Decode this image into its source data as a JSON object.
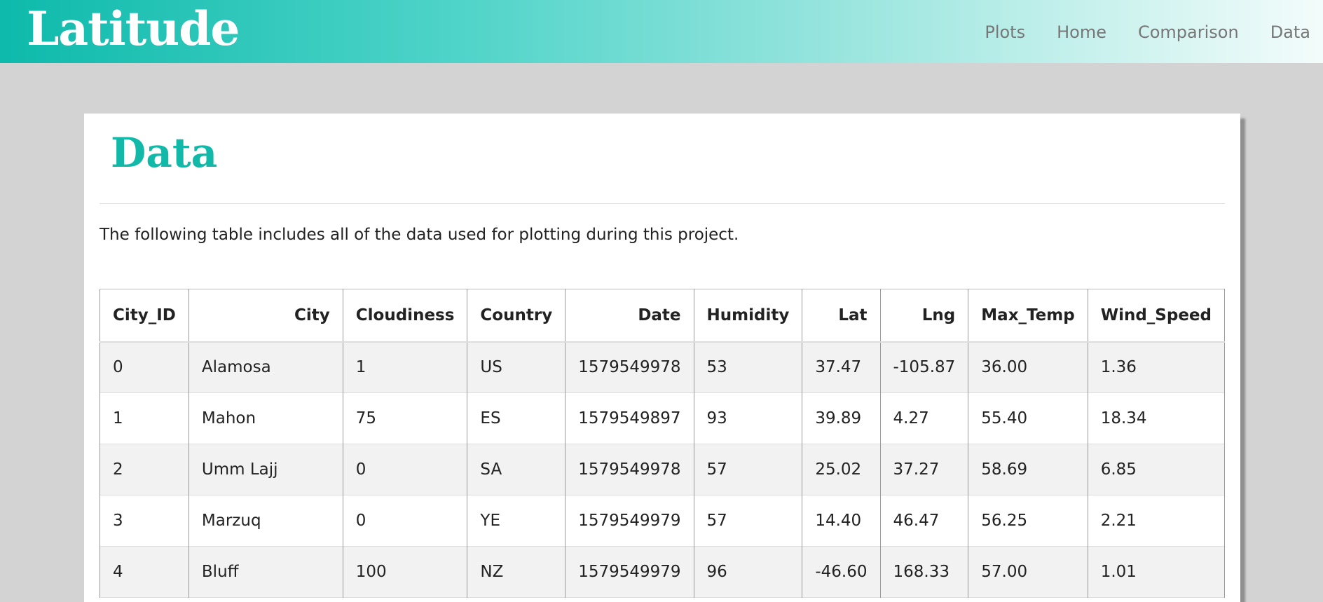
{
  "navbar": {
    "brand": "Latitude",
    "links": [
      "Plots",
      "Home",
      "Comparison",
      "Data"
    ]
  },
  "page": {
    "title": "Data",
    "intro": "The following table includes all of the data used for plotting during this project."
  },
  "table": {
    "headers": [
      "City_ID",
      "City",
      "Cloudiness",
      "Country",
      "Date",
      "Humidity",
      "Lat",
      "Lng",
      "Max_Temp",
      "Wind_Speed"
    ],
    "rows": [
      [
        "0",
        "Alamosa",
        "1",
        "US",
        "1579549978",
        "53",
        "37.47",
        "-105.87",
        "36.00",
        "1.36"
      ],
      [
        "1",
        "Mahon",
        "75",
        "ES",
        "1579549897",
        "93",
        "39.89",
        "4.27",
        "55.40",
        "18.34"
      ],
      [
        "2",
        "Umm Lajj",
        "0",
        "SA",
        "1579549978",
        "57",
        "25.02",
        "37.27",
        "58.69",
        "6.85"
      ],
      [
        "3",
        "Marzuq",
        "0",
        "YE",
        "1579549979",
        "57",
        "14.40",
        "46.47",
        "56.25",
        "2.21"
      ],
      [
        "4",
        "Bluff",
        "100",
        "NZ",
        "1579549979",
        "96",
        "-46.60",
        "168.33",
        "57.00",
        "1.01"
      ]
    ]
  }
}
